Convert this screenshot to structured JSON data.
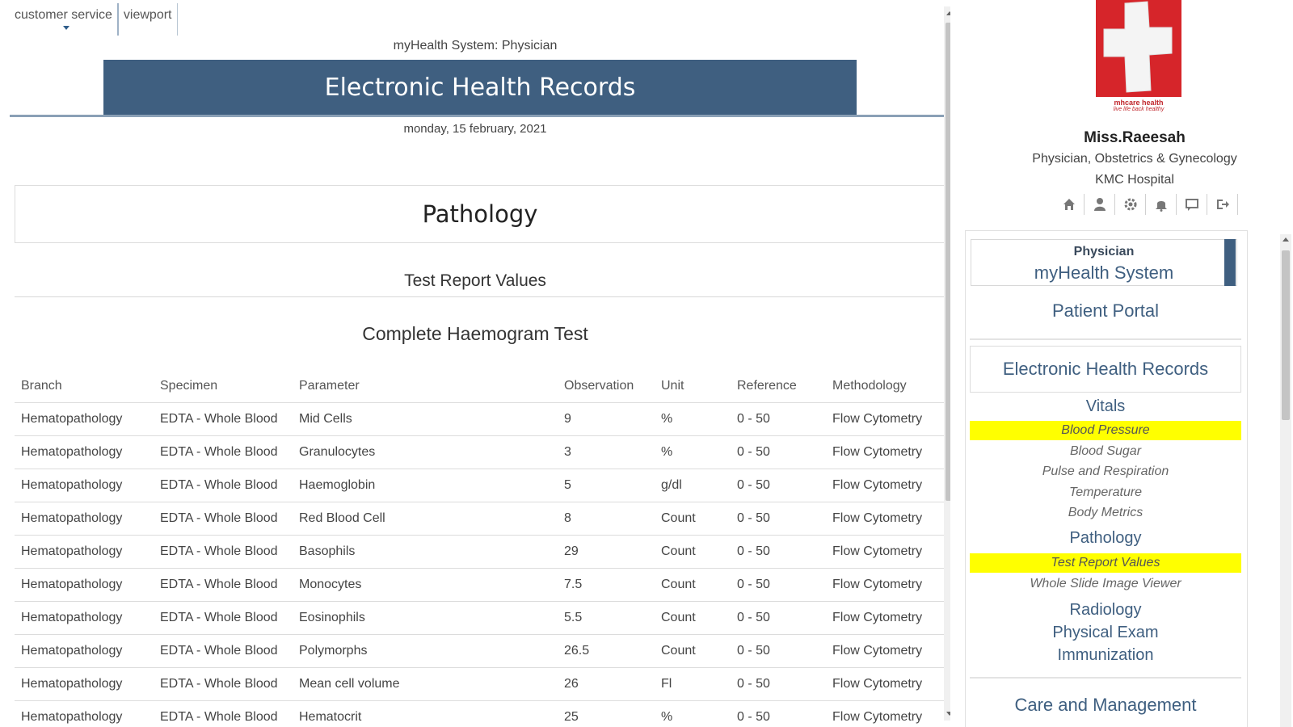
{
  "top_tabs": [
    "customer service",
    "viewport"
  ],
  "header": {
    "system": "myHealth System: Physician",
    "banner": "Electronic Health Records",
    "date": "monday, 15 february, 2021"
  },
  "section_title": "Pathology",
  "subsection_title": "Test Report Values",
  "test_title": "Complete Haemogram Test",
  "table": {
    "columns": [
      "Branch",
      "Specimen",
      "Parameter",
      "Observation",
      "Unit",
      "Reference",
      "Methodology"
    ],
    "rows": [
      [
        "Hematopathology",
        "EDTA - Whole Blood",
        "Mid Cells",
        "9",
        "%",
        "0 - 50",
        "Flow Cytometry"
      ],
      [
        "Hematopathology",
        "EDTA - Whole Blood",
        "Granulocytes",
        "3",
        "%",
        "0 - 50",
        "Flow Cytometry"
      ],
      [
        "Hematopathology",
        "EDTA - Whole Blood",
        "Haemoglobin",
        "5",
        "g/dl",
        "0 - 50",
        "Flow Cytometry"
      ],
      [
        "Hematopathology",
        "EDTA - Whole Blood",
        "Red Blood Cell",
        "8",
        "Count",
        "0 - 50",
        "Flow Cytometry"
      ],
      [
        "Hematopathology",
        "EDTA - Whole Blood",
        "Basophils",
        "29",
        "Count",
        "0 - 50",
        "Flow Cytometry"
      ],
      [
        "Hematopathology",
        "EDTA - Whole Blood",
        "Monocytes",
        "7.5",
        "Count",
        "0 - 50",
        "Flow Cytometry"
      ],
      [
        "Hematopathology",
        "EDTA - Whole Blood",
        "Eosinophils",
        "5.5",
        "Count",
        "0 - 50",
        "Flow Cytometry"
      ],
      [
        "Hematopathology",
        "EDTA - Whole Blood",
        "Polymorphs",
        "26.5",
        "Count",
        "0 - 50",
        "Flow Cytometry"
      ],
      [
        "Hematopathology",
        "EDTA - Whole Blood",
        "Mean cell volume",
        "26",
        "Fl",
        "0 - 50",
        "Flow Cytometry"
      ],
      [
        "Hematopathology",
        "EDTA - Whole Blood",
        "Hematocrit",
        "25",
        "%",
        "0 - 50",
        "Flow Cytometry"
      ]
    ]
  },
  "sidebar": {
    "logo_text": "mhcare health",
    "logo_tagline": "live life back healthy",
    "user_name": "Miss.Raeesah",
    "user_role": "Physician, Obstetrics & Gynecology",
    "user_org": "KMC Hospital",
    "icons": [
      "home-icon",
      "user-icon",
      "gear-icon",
      "bell-icon",
      "message-icon",
      "logout-icon"
    ],
    "nav_role": "Physician",
    "nav_system": "myHealth System",
    "patient_portal": "Patient Portal",
    "ehr": "Electronic Health Records",
    "vitals": "Vitals",
    "vitals_items": [
      "Blood Pressure",
      "Blood Sugar",
      "Pulse and Respiration",
      "Temperature",
      "Body Metrics"
    ],
    "pathology": "Pathology",
    "pathology_items": [
      "Test Report Values",
      "Whole Slide Image Viewer"
    ],
    "radiology": "Radiology",
    "physical_exam": "Physical Exam",
    "immunization": "Immunization",
    "care": "Care and Management"
  },
  "colors": {
    "banner": "#3f5f80",
    "highlight": "#ffff00",
    "logo_red": "#d6252a"
  }
}
